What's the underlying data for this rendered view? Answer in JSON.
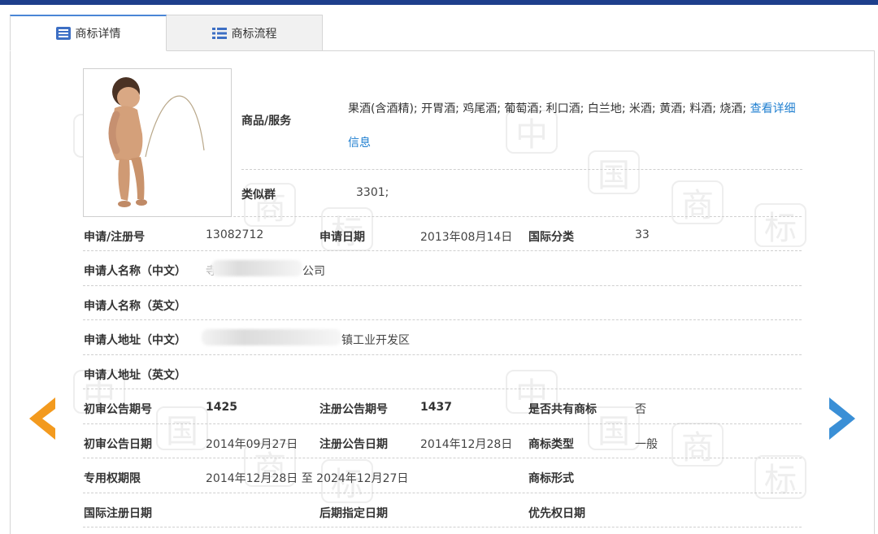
{
  "tabs": [
    {
      "label": "商标详情",
      "icon": "list-lines-icon",
      "active": true
    },
    {
      "label": "商标流程",
      "icon": "list-bullets-icon",
      "active": false
    }
  ],
  "watermark_chars": [
    "中",
    "国",
    "商",
    "标"
  ],
  "goods": {
    "label": "商品/服务",
    "value": "果酒(含酒精); 开胃酒; 鸡尾酒; 葡萄酒; 利口酒; 白兰地; 米酒; 黄酒; 料酒; 烧酒;",
    "link": "查看详细信息"
  },
  "similar_group": {
    "label": "类似群",
    "value": "3301;"
  },
  "fields": {
    "reg_no": {
      "label": "申请/注册号",
      "value": "13082712"
    },
    "apply_date": {
      "label": "申请日期",
      "value": "2013年08月14日"
    },
    "intl_class": {
      "label": "国际分类",
      "value": "33"
    },
    "applicant_cn": {
      "label": "申请人名称（中文）",
      "prefix": "寺",
      "suffix": "公司"
    },
    "applicant_en": {
      "label": "申请人名称（英文）",
      "value": ""
    },
    "address_cn": {
      "label": "申请人地址（中文）",
      "suffix": "镇工业开发区"
    },
    "address_en": {
      "label": "申请人地址（英文）",
      "value": ""
    },
    "prelim_pub_no": {
      "label": "初审公告期号",
      "value": "1425"
    },
    "reg_pub_no": {
      "label": "注册公告期号",
      "value": "1437"
    },
    "shared": {
      "label": "是否共有商标",
      "value": "否"
    },
    "prelim_pub_date": {
      "label": "初审公告日期",
      "value": "2014年09月27日"
    },
    "reg_pub_date": {
      "label": "注册公告日期",
      "value": "2014年12月28日"
    },
    "tm_type": {
      "label": "商标类型",
      "value": "一般"
    },
    "exclusive_period": {
      "label": "专用权期限",
      "value": "2014年12月28日 至 2024年12月27日"
    },
    "tm_form": {
      "label": "商标形式",
      "value": ""
    },
    "intl_reg_date": {
      "label": "国际注册日期",
      "value": ""
    },
    "later_designation_date": {
      "label": "后期指定日期",
      "value": ""
    },
    "priority_date": {
      "label": "优先权日期",
      "value": ""
    }
  },
  "colors": {
    "prev_arrow": "#f39a1e",
    "next_arrow": "#3a8fd6",
    "link": "#1f7fd0",
    "header": "#1e3f8c"
  }
}
